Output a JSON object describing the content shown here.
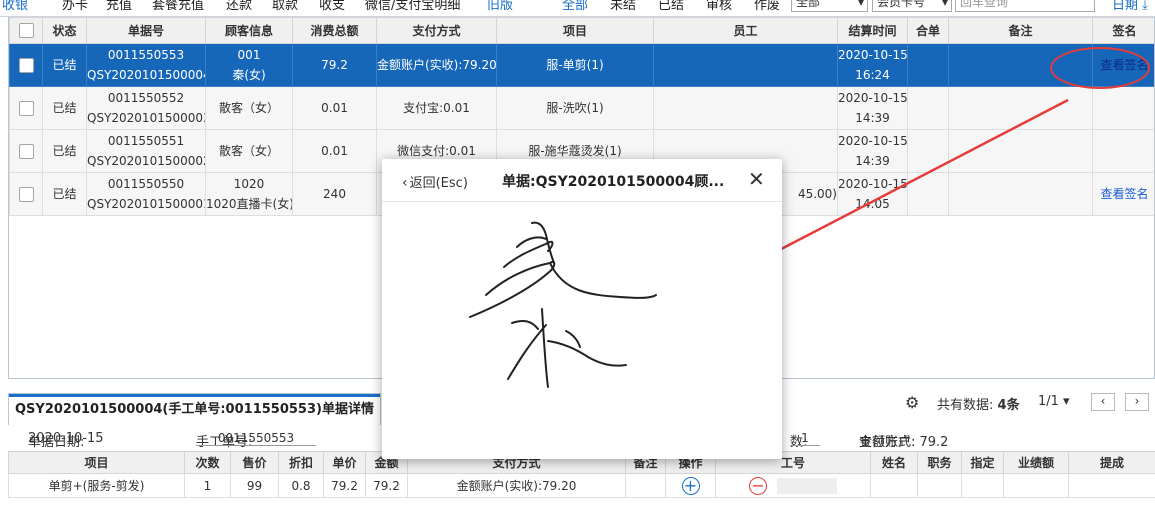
{
  "topnav": {
    "items": [
      "收银",
      "办卡",
      "充值",
      "套餐充值",
      "还款",
      "取款",
      "收支",
      "微信/支付宝明细",
      "旧版"
    ],
    "filters": [
      "全部",
      "未结",
      "已结",
      "审核",
      "作废"
    ],
    "select_all": "全部",
    "member_select": "会员卡号",
    "search_placeholder": "回车查询",
    "date_label": "日期"
  },
  "table": {
    "headers": [
      "",
      "状态",
      "单据号",
      "顾客信息",
      "消费总额",
      "支付方式",
      "项目",
      "员工",
      "结算时间",
      "合单",
      "备注",
      "签名"
    ],
    "rows": [
      {
        "status": "已结",
        "doc_no": "0011550553",
        "doc_id": "QSY2020101500004",
        "cust_a": "001",
        "cust_b": "秦(女)",
        "total": "79.2",
        "payment": "金额账户(实收):79.20",
        "item": "服-单剪(1)",
        "staff": "",
        "date": "2020-10-15",
        "time": "16:24",
        "merge": "",
        "note": "",
        "sign": "查看签名"
      },
      {
        "status": "已结",
        "doc_no": "0011550552",
        "doc_id": "QSY2020101500003",
        "cust_a": "散客（女）",
        "cust_b": "",
        "total": "0.01",
        "payment": "支付宝:0.01",
        "item": "服-洗吹(1)",
        "staff": "",
        "date": "2020-10-15",
        "time": "14:39",
        "merge": "",
        "note": "",
        "sign": ""
      },
      {
        "status": "已结",
        "doc_no": "0011550551",
        "doc_id": "QSY2020101500002",
        "cust_a": "散客（女）",
        "cust_b": "",
        "total": "0.01",
        "payment": "微信支付:0.01",
        "item": "服-施华蔻烫发(1)",
        "staff": "",
        "date": "2020-10-15",
        "time": "14:39",
        "merge": "",
        "note": "",
        "sign": ""
      },
      {
        "status": "已结",
        "doc_no": "0011550550",
        "doc_id": "QSY2020101500001",
        "cust_a": "1020",
        "cust_b": "1020直播卡(女)",
        "total": "240",
        "payment": "",
        "item": "",
        "staff": "45.00)",
        "date": "2020-10-15",
        "time": "14:05",
        "merge": "",
        "note": "",
        "sign": "查看签名"
      }
    ]
  },
  "detail": {
    "tab_title": "QSY2020101500004(手工单号:0011550553)单据详情",
    "count_label": "共有数据:",
    "count_value": "4条",
    "page": "1/1",
    "date_label": "单据日期:",
    "date_value": "2020-10-15",
    "manual_label": "手工单号:",
    "manual_value": "0011550553",
    "qty_label": "数:",
    "qty_value": "1",
    "pay_label": "支付方式:",
    "pay_value": "金额账户: 79.2",
    "headers": [
      "项目",
      "次数",
      "售价",
      "折扣",
      "单价",
      "金额",
      "支付方式",
      "备注",
      "操作",
      "工号",
      "姓名",
      "职务",
      "指定",
      "业绩额",
      "提成"
    ],
    "row": {
      "item": "单剪+(服务-剪发)",
      "times": "1",
      "price": "99",
      "discount": "0.8",
      "unit": "79.2",
      "amount": "79.2",
      "payment": "金额账户(实收):79.20",
      "note": ""
    }
  },
  "signature_dialog": {
    "back_label": "返回(Esc)",
    "title": "单据:QSY2020101500004顾...",
    "close_symbol": "✕"
  },
  "colors": {
    "accent": "#1a6fc8",
    "selected_row": "#1667b9",
    "annotation": "#e53b3b",
    "link": "#1a5bd6"
  }
}
